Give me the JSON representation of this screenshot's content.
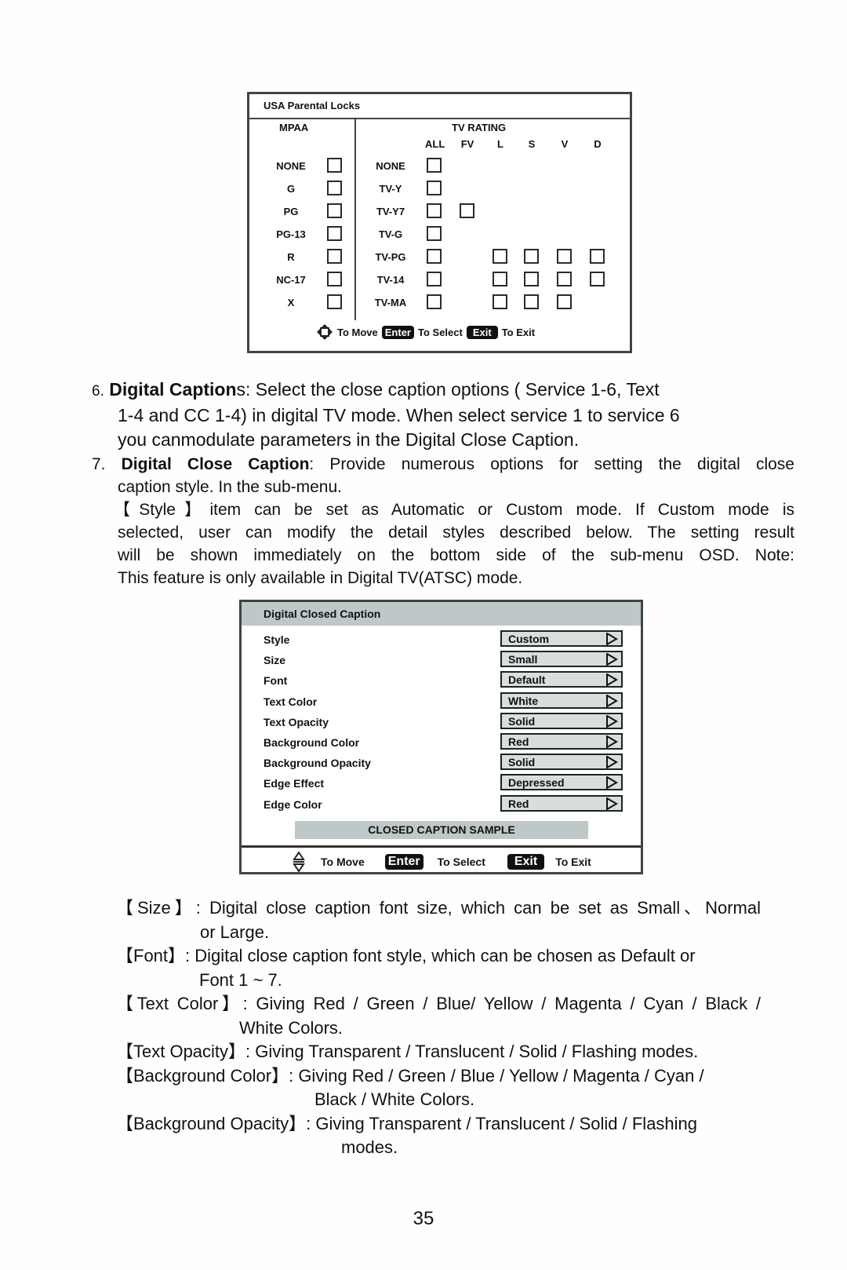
{
  "parental_locks": {
    "title": "USA Parental Locks",
    "mpaa_header": "MPAA",
    "tv_header": "TV RATING",
    "tv_columns": [
      "ALL",
      "FV",
      "L",
      "S",
      "V",
      "D"
    ],
    "mpaa_ratings": [
      "NONE",
      "G",
      "PG",
      "PG-13",
      "R",
      "NC-17",
      "X"
    ],
    "tv_ratings": [
      {
        "label": "NONE",
        "boxes": [
          true,
          false,
          false,
          false,
          false,
          false
        ]
      },
      {
        "label": "TV-Y",
        "boxes": [
          true,
          false,
          false,
          false,
          false,
          false
        ]
      },
      {
        "label": "TV-Y7",
        "boxes": [
          true,
          true,
          false,
          false,
          false,
          false
        ]
      },
      {
        "label": "TV-G",
        "boxes": [
          true,
          false,
          false,
          false,
          false,
          false
        ]
      },
      {
        "label": "TV-PG",
        "boxes": [
          true,
          false,
          true,
          true,
          true,
          true
        ]
      },
      {
        "label": "TV-14",
        "boxes": [
          true,
          false,
          true,
          true,
          true,
          true
        ]
      },
      {
        "label": "TV-MA",
        "boxes": [
          true,
          false,
          true,
          true,
          true,
          false
        ]
      }
    ],
    "nav": {
      "move": "To Move",
      "enter_key": "Enter",
      "select": "To Select",
      "exit_key": "Exit",
      "exit": "To Exit"
    }
  },
  "item6": {
    "number": "6.",
    "bold": "Digital Caption",
    "rest_line1": "s: Select the close caption options ( Service 1-6, Text",
    "line2": "1-4 and CC 1-4) in digital TV mode. When select service 1 to service 6",
    "line3": "you canmodulate parameters in the Digital Close Caption."
  },
  "item7": {
    "number": "7.",
    "bold": "Digital Close Caption",
    "rest_line1": ": Provide numerous options for setting the digital close",
    "line2": "caption style. In the sub-menu.",
    "style_line1": "【Style】item can be set as Automatic or Custom mode. If Custom mode is",
    "style_line2": "selected, user can modify the detail styles described below. The setting result",
    "style_line3": "will be shown immediately on the bottom side of the sub-menu OSD. Note:",
    "style_line4": "This feature is only available in Digital TV(ATSC) mode."
  },
  "dcc_panel": {
    "title": "Digital Closed Caption",
    "rows": [
      {
        "label": "Style",
        "value": "Custom"
      },
      {
        "label": "Size",
        "value": "Small"
      },
      {
        "label": "Font",
        "value": "Default"
      },
      {
        "label": "Text Color",
        "value": "White"
      },
      {
        "label": "Text Opacity",
        "value": "Solid"
      },
      {
        "label": "Background Color",
        "value": "Red"
      },
      {
        "label": "Background Opacity",
        "value": "Solid"
      },
      {
        "label": "Edge Effect",
        "value": "Depressed"
      },
      {
        "label": "Edge Color",
        "value": "Red"
      }
    ],
    "sample": "CLOSED CAPTION SAMPLE",
    "nav": {
      "move": "To Move",
      "enter_key": "Enter",
      "select": "To Select",
      "exit_key": "Exit",
      "exit": "To Exit"
    }
  },
  "descriptions": [
    {
      "line1": "【Size】: Digital close caption font size, which can be set as Small、Normal",
      "line2": "or Large."
    },
    {
      "line1": "【Font】: Digital close caption font style, which can be chosen as Default or",
      "line2": "Font 1 ~ 7."
    },
    {
      "line1": "【Text Color】: Giving Red / Green / Blue/ Yellow / Magenta / Cyan / Black /",
      "line2": "White Colors."
    },
    {
      "line1": "【Text Opacity】: Giving Transparent / Translucent / Solid / Flashing modes."
    },
    {
      "line1": "【Background Color】: Giving Red / Green / Blue / Yellow / Magenta / Cyan /",
      "line2": "Black / White Colors."
    },
    {
      "line1": "【Background Opacity】: Giving Transparent / Translucent / Solid / Flashing",
      "line2": "modes."
    }
  ],
  "page_number": "35"
}
